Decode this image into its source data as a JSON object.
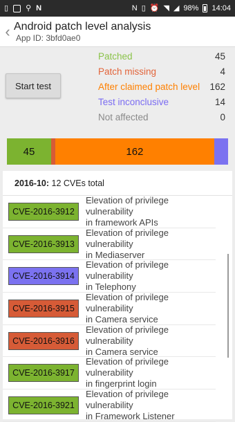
{
  "status_bar": {
    "battery": "98%",
    "time": "14:04",
    "icons": [
      "phone-icon",
      "image-icon",
      "usb-icon",
      "n-icon",
      "nfc-icon",
      "vibrate-icon",
      "alarm-icon",
      "wifi-icon",
      "signal-icon",
      "battery-icon"
    ]
  },
  "app_bar": {
    "title": "Android patch level analysis",
    "app_id": "App ID: 3bfd0ae0"
  },
  "actions": {
    "start_label": "Start test"
  },
  "stats": [
    {
      "label": "Patched",
      "value": "45",
      "color": "#8bc34a"
    },
    {
      "label": "Patch missing",
      "value": "4",
      "color": "#e2643a"
    },
    {
      "label": "After claimed patch level",
      "value": "162",
      "color": "#ff8000"
    },
    {
      "label": "Test inconclusive",
      "value": "14",
      "color": "#7b6cf2"
    },
    {
      "label": "Not affected",
      "value": "0",
      "color": "#8a8a8a"
    }
  ],
  "progress": {
    "segments": [
      {
        "label": "45",
        "value": 45,
        "color": "#7cb330"
      },
      {
        "label": "",
        "value": 4,
        "color": "#d65b37"
      },
      {
        "label": "162",
        "value": 162,
        "color": "#ff8000"
      },
      {
        "label": "",
        "value": 14,
        "color": "#7b72f0"
      }
    ]
  },
  "list": {
    "month": "2016-10:",
    "month_total": "12 CVEs total",
    "items": [
      {
        "cve": "CVE-2016-3912",
        "line1": "Elevation of privilege vulnerability",
        "line2": "in framework APIs",
        "color": "#7cb330"
      },
      {
        "cve": "CVE-2016-3913",
        "line1": "Elevation of privilege vulnerability",
        "line2": "in Mediaserver",
        "color": "#7cb330"
      },
      {
        "cve": "CVE-2016-3914",
        "line1": "Elevation of privilege vulnerability",
        "line2": "in Telephony",
        "color": "#7b72f0"
      },
      {
        "cve": "CVE-2016-3915",
        "line1": "Elevation of privilege vulnerability",
        "line2": "in Camera service",
        "color": "#d65b37"
      },
      {
        "cve": "CVE-2016-3916",
        "line1": "Elevation of privilege vulnerability",
        "line2": "in Camera service",
        "color": "#d65b37"
      },
      {
        "cve": "CVE-2016-3917",
        "line1": "Elevation of privilege vulnerability",
        "line2": "in fingerprint login",
        "color": "#7cb330"
      },
      {
        "cve": "CVE-2016-3921",
        "line1": "Elevation of privilege vulnerability",
        "line2": "in Framework Listener",
        "color": "#7cb330"
      }
    ]
  }
}
